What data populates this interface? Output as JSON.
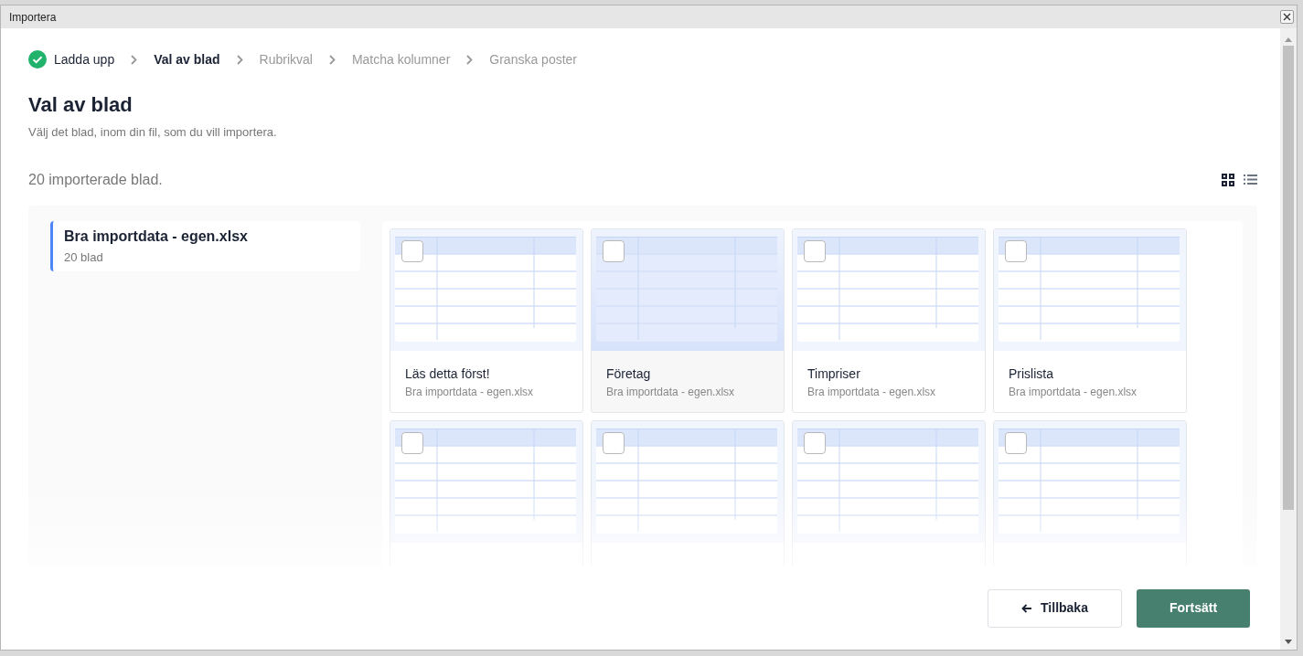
{
  "window": {
    "title": "Importera"
  },
  "steps": [
    {
      "label": "Ladda upp",
      "kind": "done"
    },
    {
      "label": "Val av blad",
      "kind": "current"
    },
    {
      "label": "Rubrikval",
      "kind": "upcoming"
    },
    {
      "label": "Matcha kolumner",
      "kind": "upcoming"
    },
    {
      "label": "Granska poster",
      "kind": "upcoming"
    }
  ],
  "heading": "Val av blad",
  "subtitle": "Välj det blad, inom din fil, som du vill importera.",
  "count": "20 importerade blad.",
  "view_modes": [
    {
      "kind": "grid",
      "selected": true
    },
    {
      "kind": "list",
      "selected": false
    }
  ],
  "files": [
    {
      "name": "Bra importdata - egen.xlsx",
      "meta": "20 blad",
      "selected": true
    }
  ],
  "sheets": [
    {
      "name": "Läs detta först!",
      "file": "Bra importdata - egen.xlsx",
      "checked": false,
      "highlighted": false
    },
    {
      "name": "Företag",
      "file": "Bra importdata - egen.xlsx",
      "checked": false,
      "highlighted": true
    },
    {
      "name": "Timpriser",
      "file": "Bra importdata - egen.xlsx",
      "checked": false,
      "highlighted": false
    },
    {
      "name": "Prislista",
      "file": "Bra importdata - egen.xlsx",
      "checked": false,
      "highlighted": false
    },
    {
      "checked": false,
      "highlighted": false
    },
    {
      "checked": false,
      "highlighted": false
    },
    {
      "checked": false,
      "highlighted": false
    },
    {
      "checked": false,
      "highlighted": false
    }
  ],
  "buttons": [
    {
      "label": "Tillbaka",
      "kind": "back"
    },
    {
      "label": "Fortsätt",
      "kind": "primary"
    }
  ]
}
